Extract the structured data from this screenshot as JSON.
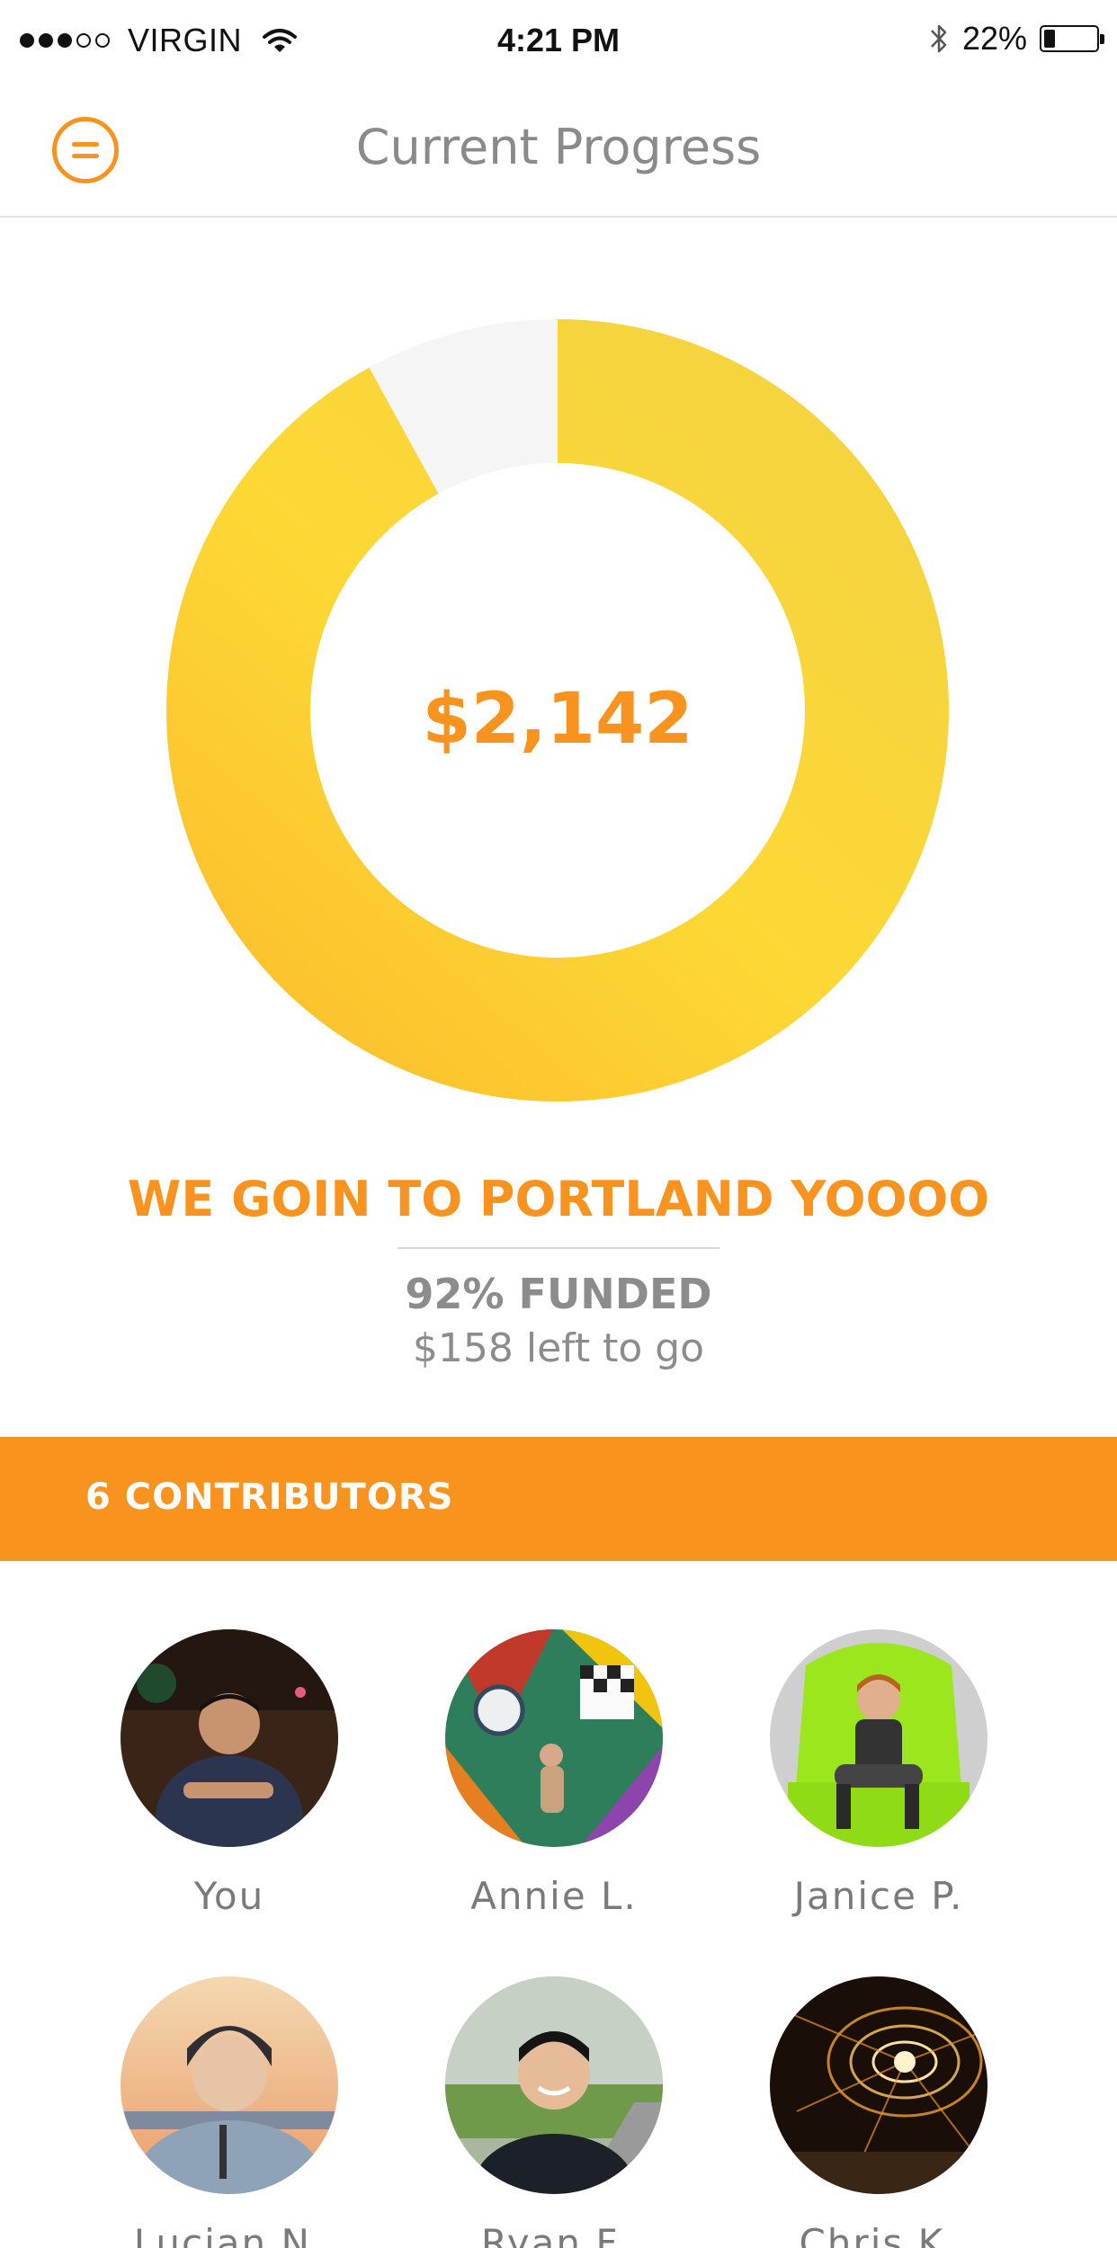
{
  "status_bar": {
    "carrier": "VIRGIN",
    "signal_bars_filled": 3,
    "signal_bars_total": 5,
    "time": "4:21 PM",
    "battery": "22%",
    "battery_level": 0.22,
    "icons": [
      "wifi-icon",
      "bluetooth-icon",
      "battery-icon"
    ]
  },
  "nav": {
    "title": "Current Progress",
    "menu_icon": "menu-icon"
  },
  "progress": {
    "amount": "$2,142",
    "funded_fraction": 0.92,
    "ring_colors": [
      "#fdd835",
      "#f4cf3f",
      "#fbc02d"
    ]
  },
  "campaign": {
    "title": "WE GOIN TO PORTLAND YOOOO",
    "funded": "92% FUNDED",
    "left_to_go": "$158 left to go"
  },
  "contributors": {
    "heading": "6 CONTRIBUTORS",
    "people": [
      {
        "name": "You"
      },
      {
        "name": "Annie L."
      },
      {
        "name": "Janice P."
      },
      {
        "name": "Lucian N."
      },
      {
        "name": "Ryan F."
      },
      {
        "name": "Chris K."
      }
    ]
  },
  "colors": {
    "accent": "#f7931e",
    "text_gray": "#8c8c8c"
  }
}
